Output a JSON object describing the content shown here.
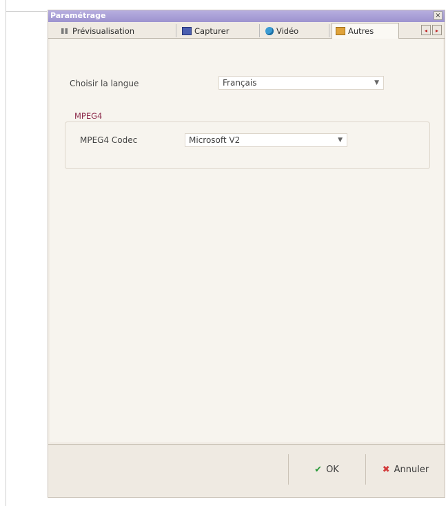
{
  "window": {
    "title": "Paramétrage",
    "close_label": "×"
  },
  "tabs": [
    {
      "label": "Prévisualisation",
      "icon": "preview-icon"
    },
    {
      "label": "Capturer",
      "icon": "capture-icon"
    },
    {
      "label": "Vidéo",
      "icon": "video-icon"
    },
    {
      "label": "Autres",
      "icon": "other-icon",
      "active": true
    }
  ],
  "tab_scroll": {
    "left": "◂",
    "right": "▸"
  },
  "language": {
    "label": "Choisir la langue",
    "value": "Français"
  },
  "mpeg4": {
    "group_title": "MPEG4",
    "codec_label": "MPEG4 Codec",
    "codec_value": "Microsoft V2"
  },
  "buttons": {
    "ok": "OK",
    "cancel": "Annuler",
    "ok_icon": "✔",
    "cancel_icon": "✖"
  },
  "colors": {
    "title_bar": "#a69ed8",
    "group_title": "#8c2a4a",
    "ok_icon": "#2a9a3a",
    "cancel_icon": "#d23a3a"
  }
}
